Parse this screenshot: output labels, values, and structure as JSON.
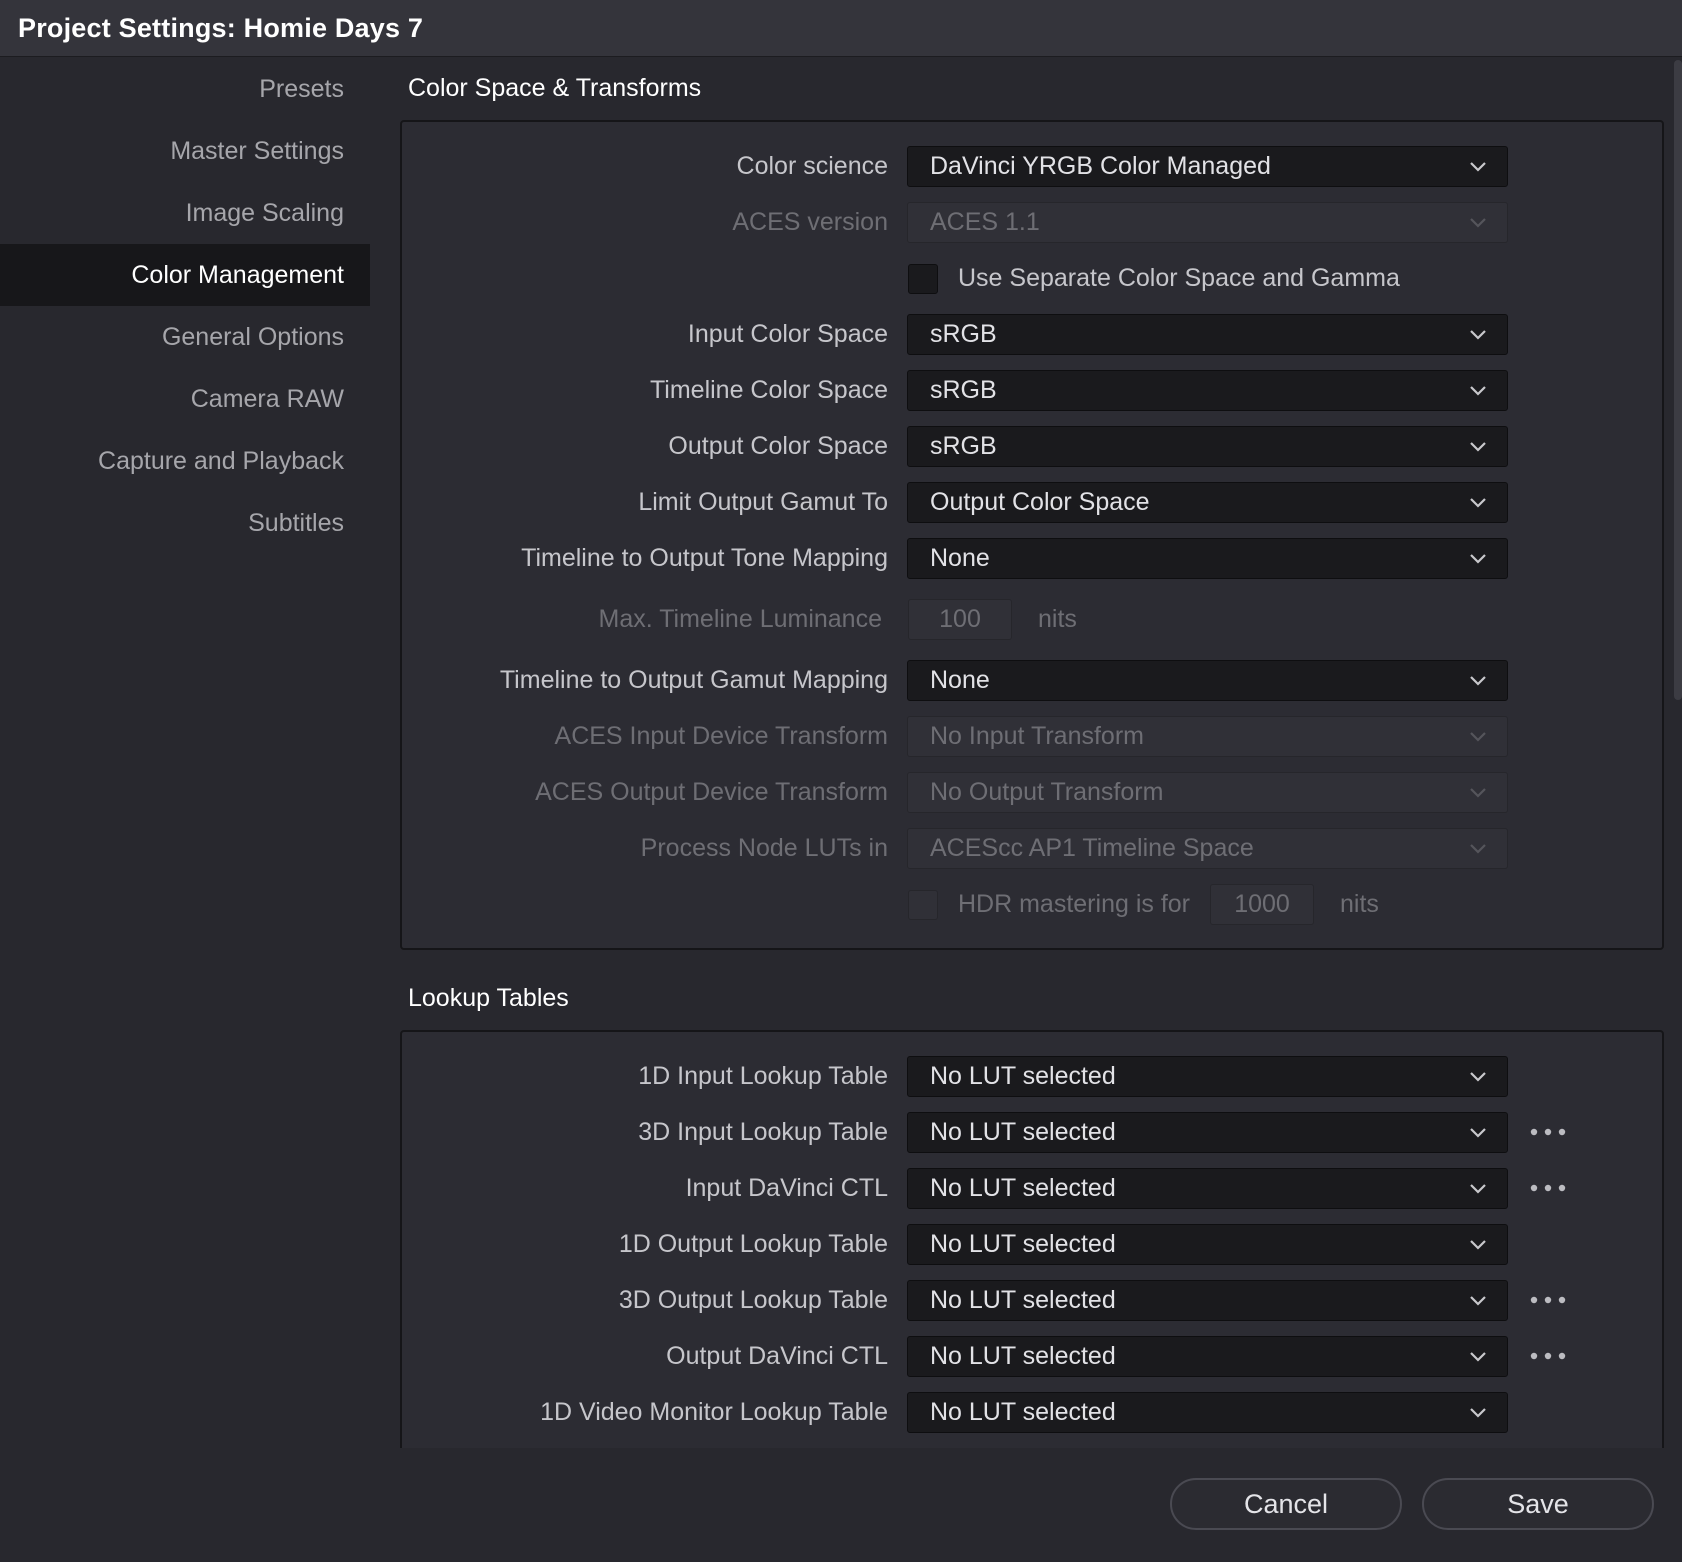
{
  "window": {
    "title": "Project Settings:  Homie Days 7"
  },
  "sidebar": {
    "items": [
      {
        "label": "Presets"
      },
      {
        "label": "Master Settings"
      },
      {
        "label": "Image Scaling"
      },
      {
        "label": "Color Management",
        "active": true
      },
      {
        "label": "General Options"
      },
      {
        "label": "Camera RAW"
      },
      {
        "label": "Capture and Playback"
      },
      {
        "label": "Subtitles"
      }
    ]
  },
  "color_space": {
    "title": "Color Space & Transforms",
    "color_science": {
      "label": "Color science",
      "value": "DaVinci YRGB Color Managed"
    },
    "aces_version": {
      "label": "ACES version",
      "value": "ACES 1.1"
    },
    "separate_gamma": {
      "label": "Use Separate Color Space and Gamma",
      "checked": false
    },
    "input_color_space": {
      "label": "Input Color Space",
      "value": "sRGB"
    },
    "timeline_color_space": {
      "label": "Timeline Color Space",
      "value": "sRGB"
    },
    "output_color_space": {
      "label": "Output Color Space",
      "value": "sRGB"
    },
    "limit_gamut": {
      "label": "Limit Output Gamut To",
      "value": "Output Color Space"
    },
    "tone_mapping": {
      "label": "Timeline to Output Tone Mapping",
      "value": "None"
    },
    "max_luminance": {
      "label": "Max. Timeline Luminance",
      "value": "100",
      "unit": "nits"
    },
    "gamut_mapping": {
      "label": "Timeline to Output Gamut Mapping",
      "value": "None"
    },
    "aces_idt": {
      "label": "ACES Input Device Transform",
      "value": "No Input Transform"
    },
    "aces_odt": {
      "label": "ACES Output Device Transform",
      "value": "No Output Transform"
    },
    "process_luts": {
      "label": "Process Node LUTs in",
      "value": "ACEScc AP1 Timeline Space"
    },
    "hdr_mastering": {
      "label": "HDR mastering is for",
      "value": "1000",
      "unit": "nits",
      "checked": false
    }
  },
  "lookup_tables": {
    "title": "Lookup Tables",
    "rows": [
      {
        "label": "1D Input Lookup Table",
        "value": "No LUT selected",
        "has_more": false
      },
      {
        "label": "3D Input Lookup Table",
        "value": "No LUT selected",
        "has_more": true
      },
      {
        "label": "Input DaVinci CTL",
        "value": "No LUT selected",
        "has_more": true
      },
      {
        "label": "1D Output Lookup Table",
        "value": "No LUT selected",
        "has_more": false
      },
      {
        "label": "3D Output Lookup Table",
        "value": "No LUT selected",
        "has_more": true
      },
      {
        "label": "Output DaVinci CTL",
        "value": "No LUT selected",
        "has_more": true
      },
      {
        "label": "1D Video Monitor Lookup Table",
        "value": "No LUT selected",
        "has_more": false
      }
    ]
  },
  "buttons": {
    "cancel": "Cancel",
    "save": "Save"
  }
}
